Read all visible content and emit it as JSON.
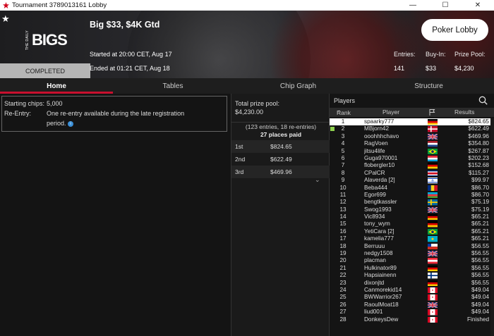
{
  "window": {
    "title": "Tournament 3789013161 Lobby",
    "controls": [
      "—",
      "☐",
      "✕"
    ]
  },
  "banner": {
    "logo_small": "THE DAILY",
    "logo_big": "BIGS",
    "status": "COMPLETED",
    "tournament_name": "Big $33, $4K Gtd",
    "started": "Started at 20:00 CET, Aug 17",
    "ended": "Ended at 01:21 CET, Aug 18",
    "poker_lobby_label": "Poker Lobby",
    "stats": {
      "entries_label": "Entries:",
      "entries_value": "141",
      "buyin_label": "Buy-In:",
      "buyin_value": "$33",
      "prizepool_label": "Prize Pool:",
      "prizepool_value": "$4,230"
    }
  },
  "tabs": [
    {
      "label": "Home",
      "active": true
    },
    {
      "label": "Tables",
      "active": false
    },
    {
      "label": "Chip Graph",
      "active": false
    },
    {
      "label": "Structure",
      "active": false
    }
  ],
  "home": {
    "starting_chips_label": "Starting chips:",
    "starting_chips_value": "5,000",
    "reentry_label": "Re-Entry:",
    "reentry_line1": "One re-entry available during the late registration",
    "reentry_line2": "period.",
    "info_icon": "i"
  },
  "prize": {
    "total_label": "Total prize pool:",
    "total_value": "$4,230.00",
    "entries_text": "(123 entries, 18 re-entries)",
    "places_paid": "27 places paid",
    "rows": [
      {
        "place": "1st",
        "amount": "$824.65"
      },
      {
        "place": "2nd",
        "amount": "$622.49"
      },
      {
        "place": "3rd",
        "amount": "$469.96"
      }
    ]
  },
  "players": {
    "title": "Players",
    "col_rank": "Rank",
    "col_player": "Player",
    "col_results": "Results",
    "rows": [
      {
        "rank": "1",
        "name": "spaarky777",
        "flag": "de",
        "result": "$824.65",
        "selected": true
      },
      {
        "rank": "2",
        "name": "MBjorn42",
        "flag": "dk",
        "result": "$622.49",
        "mark": true
      },
      {
        "rank": "3",
        "name": "ooohhhchavo",
        "flag": "gb",
        "result": "$469.96"
      },
      {
        "rank": "4",
        "name": "RagVoen",
        "flag": "nl",
        "result": "$354.80"
      },
      {
        "rank": "5",
        "name": "jitsu4life",
        "flag": "br",
        "result": "$267.87"
      },
      {
        "rank": "6",
        "name": "Guga970001",
        "flag": "lu",
        "result": "$202.23"
      },
      {
        "rank": "7",
        "name": "flobergler10",
        "flag": "de",
        "result": "$152.68"
      },
      {
        "rank": "8",
        "name": "CPalCR",
        "flag": "cr",
        "result": "$115.27"
      },
      {
        "rank": "9",
        "name": "Alaverda [2]",
        "flag": "il",
        "result": "$99.97"
      },
      {
        "rank": "10",
        "name": "Beba444",
        "flag": "ro",
        "result": "$86.70"
      },
      {
        "rank": "11",
        "name": "Egor699",
        "flag": "az",
        "result": "$86.70"
      },
      {
        "rank": "12",
        "name": "bengtkassler",
        "flag": "se",
        "result": "$75.19"
      },
      {
        "rank": "13",
        "name": "Swog1993",
        "flag": "gb",
        "result": "$75.19"
      },
      {
        "rank": "14",
        "name": "Vic8934",
        "flag": "de",
        "result": "$65.21"
      },
      {
        "rank": "15",
        "name": "tony_wym",
        "flag": "de",
        "result": "$65.21"
      },
      {
        "rank": "16",
        "name": "YetiCara [2]",
        "flag": "br",
        "result": "$65.21"
      },
      {
        "rank": "17",
        "name": "kamelia777",
        "flag": "kz",
        "result": "$65.21"
      },
      {
        "rank": "18",
        "name": "Berruuu",
        "flag": "cl",
        "result": "$56.55"
      },
      {
        "rank": "19",
        "name": "nedgy1508",
        "flag": "gb",
        "result": "$56.55"
      },
      {
        "rank": "20",
        "name": "placman",
        "flag": "at",
        "result": "$56.55"
      },
      {
        "rank": "21",
        "name": "Hulkinator89",
        "flag": "de",
        "result": "$56.55"
      },
      {
        "rank": "22",
        "name": "Hapsiainenn",
        "flag": "fi",
        "result": "$56.55"
      },
      {
        "rank": "23",
        "name": "dixonjtd",
        "flag": "de",
        "result": "$56.55"
      },
      {
        "rank": "24",
        "name": "Canmorekid14",
        "flag": "ca",
        "result": "$49.04"
      },
      {
        "rank": "25",
        "name": "BWWarrior267",
        "flag": "ca",
        "result": "$49.04"
      },
      {
        "rank": "26",
        "name": "RaoulMoat18",
        "flag": "gb",
        "result": "$49.04"
      },
      {
        "rank": "27",
        "name": "liud001",
        "flag": "ca",
        "result": "$49.04"
      },
      {
        "rank": "28",
        "name": "DonkeysDew",
        "flag": "ca",
        "result": "Finished"
      }
    ]
  },
  "colors": {
    "accent": "#c8102e",
    "selected_row": "#ffffff",
    "mark_green": "#8fd14f"
  }
}
